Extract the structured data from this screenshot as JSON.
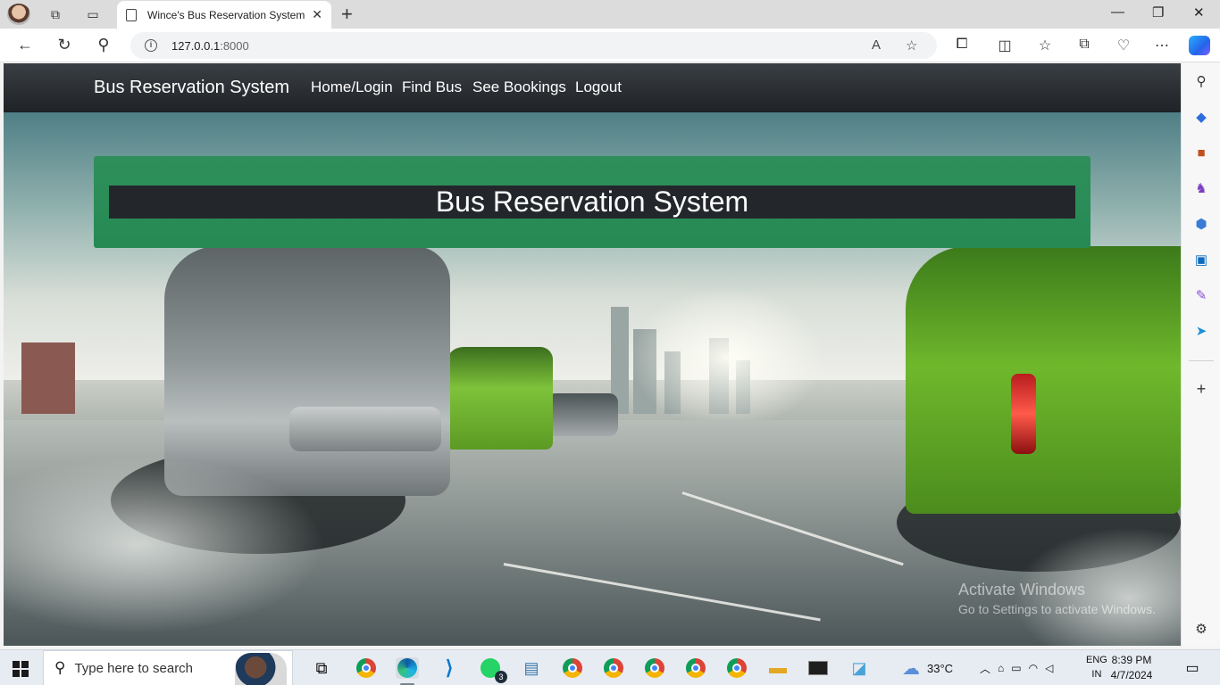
{
  "browser": {
    "tab_title": "Wince's Bus Reservation System",
    "url_host": "127.0.0.1",
    "url_port": ":8000"
  },
  "site": {
    "brand": "Bus Reservation System",
    "nav": [
      "Home/Login",
      "Find Bus",
      "See Bookings",
      "Logout"
    ],
    "hero_title": "Bus Reservation System"
  },
  "watermark": {
    "line1": "Activate Windows",
    "line2": "Go to Settings to activate Windows."
  },
  "taskbar": {
    "search_placeholder": "Type here to search",
    "whatsapp_badge": "3",
    "weather": "33°C",
    "lang_top": "ENG",
    "lang_bottom": "IN",
    "time": "8:39 PM",
    "date": "4/7/2024"
  },
  "colors": {
    "navbar": "#23262b",
    "hero_green": "#2f8f5a",
    "hero_inner": "#23262b"
  }
}
